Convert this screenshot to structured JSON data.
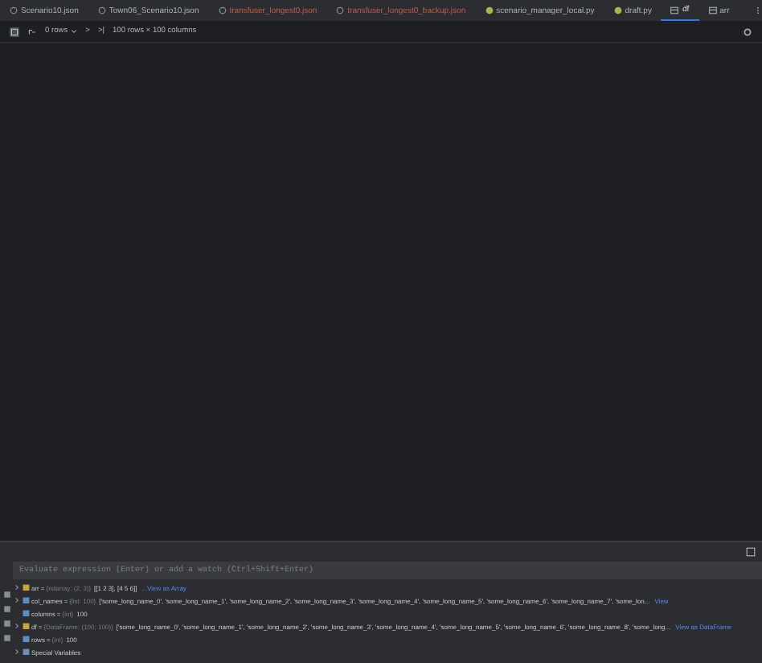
{
  "tabs": [
    {
      "label": "Scenario10.json",
      "kind": "json",
      "modified": false,
      "selected": false
    },
    {
      "label": "Town06_Scenario10.json",
      "kind": "json",
      "modified": false,
      "selected": false
    },
    {
      "label": "transfuser_longest0.json",
      "kind": "json",
      "modified": true,
      "selected": false
    },
    {
      "label": "transfuser_longest0_backup.json",
      "kind": "json",
      "modified": true,
      "selected": false
    },
    {
      "label": "scenario_manager_local.py",
      "kind": "py",
      "modified": false,
      "selected": false
    },
    {
      "label": "draft.py",
      "kind": "py",
      "modified": false,
      "selected": false
    },
    {
      "label": "df",
      "kind": "table",
      "modified": false,
      "selected": true
    },
    {
      "label": "arr",
      "kind": "table",
      "modified": false,
      "selected": false
    }
  ],
  "toolbar": {
    "rows_selector": "0 rows",
    "next": ">",
    "last": ">|",
    "size": "100 rows × 100 columns"
  },
  "watch_field": {
    "placeholder": "Evaluate expression (Enter) or add a watch (Ctrl+Shift+Enter)"
  },
  "variables": [
    {
      "name": "arr",
      "kind": "array",
      "expandable": true,
      "eq": "=",
      "type": "{ndarray: (2, 3)}",
      "value": "[[1 2 3], [4 5 6]]",
      "link": "...View as Array"
    },
    {
      "name": "col_names",
      "kind": "list",
      "expandable": true,
      "eq": "=",
      "type": "{list: 100}",
      "value": "['some_long_name_0', 'some_long_name_1', 'some_long_name_2', 'some_long_name_3', 'some_long_name_4', 'some_long_name_5', 'some_long_name_6', 'some_long_name_7', 'some_lon...",
      "link": "View"
    },
    {
      "name": "columns",
      "kind": "int",
      "expandable": false,
      "eq": "=",
      "type": "{int}",
      "value": "100"
    },
    {
      "name": "df",
      "kind": "dataframe",
      "expandable": true,
      "eq": "=",
      "type": "{DataFrame: (100, 100)}",
      "value": "['some_long_name_0', 'some_long_name_1', 'some_long_name_2', 'some_long_name_3', 'some_long_name_4', 'some_long_name_5', 'some_long_name_6', 'some_long_name_8', 'some_long...",
      "link": "View as DataFrame"
    },
    {
      "name": "rows",
      "kind": "int",
      "expandable": false,
      "eq": "=",
      "type": "{int}",
      "value": "100"
    },
    {
      "name": "Special Variables",
      "kind": "special",
      "expandable": true
    }
  ]
}
